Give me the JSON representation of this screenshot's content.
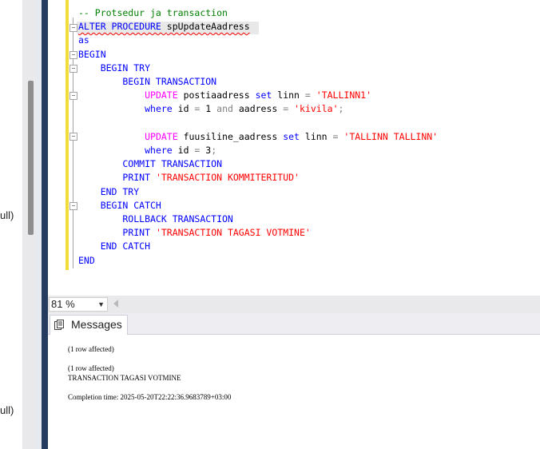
{
  "left_panel": {
    "cut_texts": [
      "ull)",
      "ull)"
    ]
  },
  "editor": {
    "lines": [
      {
        "segments": [
          {
            "t": "-- Protsedur ja transaction",
            "c": "cm"
          }
        ]
      },
      {
        "segments": [
          {
            "t": "ALTER PROCEDURE ",
            "c": "kw squig"
          },
          {
            "t": "spUpdateAadress",
            "c": "id squig"
          }
        ]
      },
      {
        "segments": [
          {
            "t": "as",
            "c": "kw"
          }
        ]
      },
      {
        "segments": [
          {
            "t": "BEGIN",
            "c": "kw"
          }
        ]
      },
      {
        "segments": [
          {
            "t": "    BEGIN TRY",
            "c": "kw"
          }
        ]
      },
      {
        "segments": [
          {
            "t": "        BEGIN TRANSACTION",
            "c": "kw"
          }
        ]
      },
      {
        "segments": [
          {
            "t": "            ",
            "c": "id"
          },
          {
            "t": "UPDATE",
            "c": "fn"
          },
          {
            "t": " postiaadress ",
            "c": "id"
          },
          {
            "t": "set",
            "c": "kw"
          },
          {
            "t": " linn ",
            "c": "id"
          },
          {
            "t": "=",
            "c": "op"
          },
          {
            "t": " ",
            "c": "id"
          },
          {
            "t": "'TALLINN1'",
            "c": "st"
          }
        ]
      },
      {
        "segments": [
          {
            "t": "            ",
            "c": "id"
          },
          {
            "t": "where",
            "c": "kw"
          },
          {
            "t": " id ",
            "c": "id"
          },
          {
            "t": "=",
            "c": "op"
          },
          {
            "t": " 1 ",
            "c": "id"
          },
          {
            "t": "and",
            "c": "op"
          },
          {
            "t": " aadress ",
            "c": "id"
          },
          {
            "t": "=",
            "c": "op"
          },
          {
            "t": " ",
            "c": "id"
          },
          {
            "t": "'kivila'",
            "c": "st"
          },
          {
            "t": ";",
            "c": "op"
          }
        ]
      },
      {
        "segments": [
          {
            "t": "",
            "c": "id"
          }
        ]
      },
      {
        "segments": [
          {
            "t": "            ",
            "c": "id"
          },
          {
            "t": "UPDATE",
            "c": "fn"
          },
          {
            "t": " fuusiline_aadress ",
            "c": "id"
          },
          {
            "t": "set",
            "c": "kw"
          },
          {
            "t": " linn ",
            "c": "id"
          },
          {
            "t": "=",
            "c": "op"
          },
          {
            "t": " ",
            "c": "id"
          },
          {
            "t": "'TALLINN TALLINN'",
            "c": "st"
          }
        ]
      },
      {
        "segments": [
          {
            "t": "            ",
            "c": "id"
          },
          {
            "t": "where",
            "c": "kw"
          },
          {
            "t": " id ",
            "c": "id"
          },
          {
            "t": "=",
            "c": "op"
          },
          {
            "t": " 3",
            "c": "id"
          },
          {
            "t": ";",
            "c": "op"
          }
        ]
      },
      {
        "segments": [
          {
            "t": "        COMMIT TRANSACTION",
            "c": "kw"
          }
        ]
      },
      {
        "segments": [
          {
            "t": "        ",
            "c": "id"
          },
          {
            "t": "PRINT",
            "c": "kw"
          },
          {
            "t": " ",
            "c": "id"
          },
          {
            "t": "'TRANSACTION KOMMITERITUD'",
            "c": "st"
          }
        ]
      },
      {
        "segments": [
          {
            "t": "    END TRY",
            "c": "kw"
          }
        ]
      },
      {
        "segments": [
          {
            "t": "    BEGIN CATCH",
            "c": "kw"
          }
        ]
      },
      {
        "segments": [
          {
            "t": "        ROLLBACK TRANSACTION",
            "c": "kw"
          }
        ]
      },
      {
        "segments": [
          {
            "t": "        ",
            "c": "id"
          },
          {
            "t": "PRINT",
            "c": "kw"
          },
          {
            "t": " ",
            "c": "id"
          },
          {
            "t": "'TRANSACTION TAGASI VOTMINE'",
            "c": "st"
          }
        ]
      },
      {
        "segments": [
          {
            "t": "    END CATCH",
            "c": "kw"
          }
        ]
      },
      {
        "segments": [
          {
            "t": "END",
            "c": "kw"
          }
        ]
      }
    ]
  },
  "zoom": {
    "value": "81 %"
  },
  "results": {
    "tab_label": "Messages",
    "messages": [
      "(1 row affected)",
      "(1 row affected)",
      "TRANSACTION TAGASI VOTMINE",
      "Completion time: 2025-05-20T22:22:36.9683789+03:00"
    ]
  }
}
